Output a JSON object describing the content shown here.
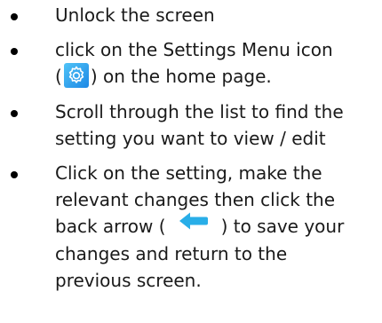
{
  "steps": [
    {
      "text": "Unlock the screen"
    },
    {
      "line1": "click on the Settings Menu icon",
      "line2_prefix": "(",
      "icon": "settings-gear-icon",
      "line2_suffix": ") on the home page."
    },
    {
      "line1": "Scroll through the list to find the",
      "line2": "setting you want to view / edit"
    },
    {
      "line1": "Click on the setting, make the",
      "line2": "relevant changes then click the",
      "line3_prefix": "back arrow (",
      "icon": "back-arrow-icon",
      "line3_suffix": ") to save your",
      "line4": "changes and return to the",
      "line5": "previous screen."
    }
  ],
  "colors": {
    "gear_icon_bg": "#29a3f0",
    "back_arrow": "#29aee8",
    "text": "#1a1a1a"
  }
}
